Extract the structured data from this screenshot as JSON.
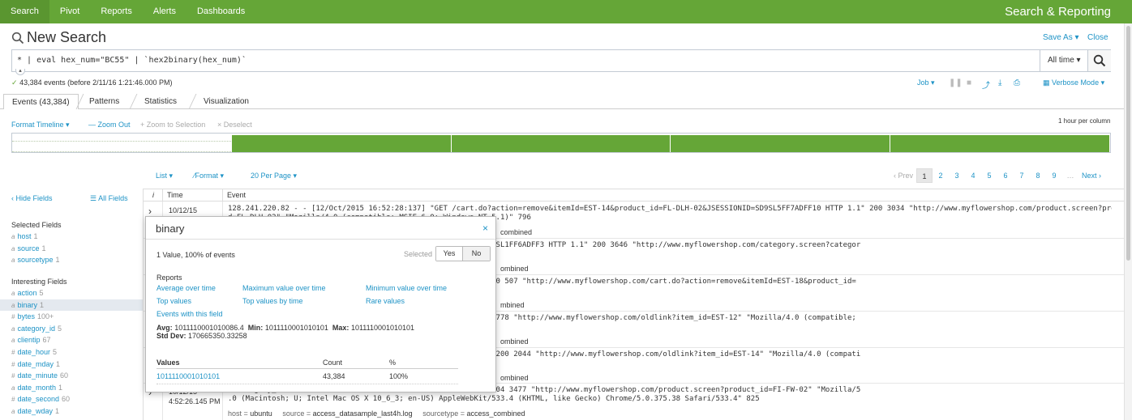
{
  "nav": {
    "items": [
      "Search",
      "Pivot",
      "Reports",
      "Alerts",
      "Dashboards"
    ],
    "app_title": "Search & Reporting"
  },
  "search": {
    "title": "New Search",
    "save_as": "Save As ▾",
    "close": "Close",
    "query": "* | eval hex_num=\"BC55\" | `hex2binary(hex_num)`",
    "time_range": "All time ▾"
  },
  "status": {
    "events_text": "43,384 events (before 2/11/16 1:21:46.000 PM)",
    "job": "Job ▾",
    "verbose_mode": "Verbose Mode ▾"
  },
  "tabs": [
    "Events (43,384)",
    "Patterns",
    "Statistics",
    "Visualization"
  ],
  "timeline": {
    "format": "Format Timeline ▾",
    "zoom_out": "— Zoom Out",
    "zoom_to_selection": "+ Zoom to Selection",
    "deselect": "× Deselect",
    "scale": "1 hour per column",
    "columns": [
      0,
      1,
      1,
      1,
      1
    ]
  },
  "results": {
    "list": "List ▾",
    "format": "⁄Format ▾",
    "per_page": "20 Per Page ▾",
    "prev": "‹ Prev",
    "pages": [
      "1",
      "2",
      "3",
      "4",
      "5",
      "6",
      "7",
      "8",
      "9"
    ],
    "ellipsis": "…",
    "next": "Next ›"
  },
  "sidebar": {
    "hide_fields": "‹ Hide Fields",
    "all_fields": "All Fields",
    "selected_heading": "Selected Fields",
    "selected_fields": [
      {
        "type": "a",
        "name": "host",
        "count": "1"
      },
      {
        "type": "a",
        "name": "source",
        "count": "1"
      },
      {
        "type": "a",
        "name": "sourcetype",
        "count": "1"
      }
    ],
    "interesting_heading": "Interesting Fields",
    "interesting_fields": [
      {
        "type": "a",
        "name": "action",
        "count": "5"
      },
      {
        "type": "a",
        "name": "binary",
        "count": "1"
      },
      {
        "type": "#",
        "name": "bytes",
        "count": "100+"
      },
      {
        "type": "a",
        "name": "category_id",
        "count": "5"
      },
      {
        "type": "a",
        "name": "clientip",
        "count": "67"
      },
      {
        "type": "#",
        "name": "date_hour",
        "count": "5"
      },
      {
        "type": "#",
        "name": "date_mday",
        "count": "1"
      },
      {
        "type": "#",
        "name": "date_minute",
        "count": "60"
      },
      {
        "type": "a",
        "name": "date_month",
        "count": "1"
      },
      {
        "type": "#",
        "name": "date_second",
        "count": "60"
      },
      {
        "type": "a",
        "name": "date_wday",
        "count": "1"
      }
    ]
  },
  "table": {
    "col_i": "i",
    "col_time": "Time",
    "col_event": "Event",
    "rows": [
      {
        "time": "10/12/15",
        "lines": [
          "128.241.220.82 - - [12/Oct/2015 16:52:28:137] \"GET /cart.do?action=remove&itemId=EST-14&product_id=FL-DLH-02&JSESSIONID=SD9SL5FF7ADFF10 HTTP 1.1\" 200 3034 \"http://www.myflowershop.com/product.screen?product_i",
          "d=FL-DLH-02\" \"Mozilla/4.0 (compatible; MSIE 6.0; Windows NT 5.1)\" 796"
        ],
        "meta": "combined"
      },
      {
        "time": "",
        "lines": [
          "angequantity&itemId=EST-13&product_id=AV-SB-02&JSESSIONID=SD5SL1FF6ADFF3 HTTP 1.1\" 200 3646 \"http://www.myflowershop.com/category.screen?categor",
          ""
        ],
        "meta": "ombined"
      },
      {
        "time": "",
        "lines": [
          "n?product_id=FL-DLH-02&JSESSIONID=SD5SL9FF5ADFF4 HTTP 1.1\" 200 507 \"http://www.myflowershop.com/cart.do?action=remove&itemId=EST-18&product_id=",
          "637"
        ],
        "meta": "mbined"
      },
      {
        "time": "",
        "lines": [
          "product_id=AV-SB-02&JSESSIONID=SD9SL8FF4ADFF9 HTTP 1.1\" 200 1778 \"http://www.myflowershop.com/oldlink?item_id=EST-12\" \"Mozilla/4.0 (compatible;",
          ""
        ],
        "meta": "ombined"
      },
      {
        "time": "",
        "lines": [
          "reen?product_id=FI-SW-01&JSESSIONID=SD1SL6FF7ADFF4 HTTP 1.1\" 200 2044 \"http://www.myflowershop.com/oldlink?item_id=EST-14\" \"Mozilla/4.0 (compati",
          ""
        ],
        "meta": "ombined"
      },
      {
        "time": "10/12/15\n4:52:26.145 PM",
        "lines": [
          "n?category_id=SURPRISE&JSESSIONID=SD10SL6FF2ADFF1 HTTP 1.1\" 404 3477 \"http://www.myflowershop.com/product.screen?product_id=FI-FW-02\" \"Mozilla/5",
          ".0 (Macintosh; U; Intel Mac OS X 10_6_3; en-US) AppleWebKit/533.4 (KHTML, like Gecko) Chrome/5.0.375.38 Safari/533.4\" 825"
        ],
        "meta_host": "host = ",
        "meta_host_v": "ubuntu",
        "meta_source": "source = ",
        "meta_source_v": "access_datasample_last4h.log",
        "meta_st": "sourcetype = ",
        "meta_st_v": "access_combined"
      }
    ]
  },
  "popover": {
    "title": "binary",
    "close": "×",
    "summary": "1 Value, 100% of events",
    "selected_label": "Selected",
    "yes": "Yes",
    "no": "No",
    "reports_heading": "Reports",
    "reports": [
      "Average over time",
      "Maximum value over time",
      "Minimum value over time",
      "Top values",
      "Top values by time",
      "Rare values",
      "Events with this field"
    ],
    "avg_label": "Avg:",
    "avg": "1011110001010086.4",
    "min_label": "Min:",
    "min": "1011110001010101",
    "max_label": "Max:",
    "max": "1011110001010101",
    "std_label": "Std Dev:",
    "std": "170665350.33258",
    "values_heading": "Values",
    "count_heading": "Count",
    "pct_heading": "%",
    "value": "1011110001010101",
    "count": "43,384",
    "pct": "100%"
  },
  "colors": {
    "brand_green": "#65a637",
    "link_blue": "#1e93c6"
  }
}
